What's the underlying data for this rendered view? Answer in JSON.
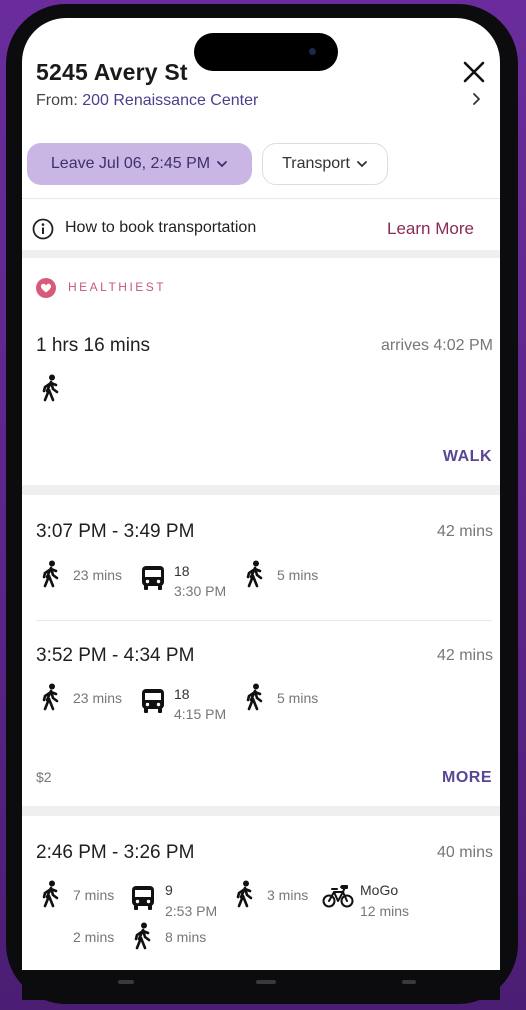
{
  "header": {
    "title": "5245 Avery St",
    "from_prefix": "From: ",
    "from_location": "200 Renaissance Center"
  },
  "filters": {
    "leave": "Leave Jul 06, 2:45 PM",
    "transport": "Transport"
  },
  "info": {
    "text": "How to book transportation",
    "link": "Learn More"
  },
  "healthiest": {
    "badge": "HEALTHIEST",
    "duration": "1 hrs 16 mins",
    "arrives": "arrives 4:02 PM",
    "action": "WALK"
  },
  "transit": {
    "option1": {
      "time": "3:07 PM - 3:49 PM",
      "duration": "42 mins",
      "walk1": "23 mins",
      "bus_num": "18",
      "bus_time": "3:30 PM",
      "walk2": "5 mins"
    },
    "option2": {
      "time": "3:52 PM - 4:34 PM",
      "duration": "42 mins",
      "walk1": "23 mins",
      "bus_num": "18",
      "bus_time": "4:15 PM",
      "walk2": "5 mins"
    },
    "price": "$2",
    "action": "MORE"
  },
  "mixed": {
    "time": "2:46 PM - 3:26 PM",
    "duration": "40 mins",
    "walk1": "7 mins",
    "bus_num": "9",
    "bus_time": "2:53 PM",
    "walk2": "3 mins",
    "bike_name": "MoGo",
    "bike_time": "12 mins",
    "bike_after": "2 mins",
    "walk3": "8 mins"
  },
  "colors": {
    "accent": "#5a4694",
    "chip": "#c9b6e4",
    "link": "#8a2a55",
    "healthiest": "#c8587b",
    "background": "#5a2487"
  },
  "icons": [
    "close-icon",
    "chevron-right-icon",
    "chevron-down-icon",
    "info-icon",
    "heart-icon",
    "walk-icon",
    "bus-icon",
    "bike-icon"
  ]
}
